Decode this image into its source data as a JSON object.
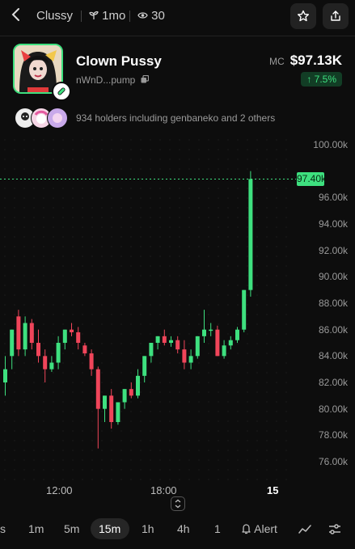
{
  "topbar": {
    "ticker": "Clussy",
    "age": "1mo",
    "views": "30"
  },
  "token": {
    "name": "Clown Pussy",
    "address": "nWnD...pump",
    "mc_label": "MC",
    "market_cap": "$97.13K",
    "change": "↑ 7.5%",
    "holders_text": "934 holders including genbaneko and 2 others"
  },
  "chart": {
    "y_labels": [
      "100.00k",
      "98.00k",
      "96.00k",
      "94.00k",
      "92.00k",
      "90.00k",
      "88.00k",
      "86.00k",
      "84.00k",
      "82.00k",
      "80.00k",
      "78.00k",
      "76.00k"
    ],
    "x_labels": [
      "12:00",
      "18:00",
      "15"
    ],
    "current_price_label": "97.40k",
    "current_price": 97.4,
    "up_color": "#3ee07f",
    "down_color": "#f0455a"
  },
  "chart_data": {
    "type": "candlestick",
    "ylim": [
      76,
      100
    ],
    "y_unit": "k",
    "candles": [
      {
        "o": 82,
        "h": 84,
        "l": 81,
        "c": 83
      },
      {
        "o": 84,
        "h": 86,
        "l": 83,
        "c": 86
      },
      {
        "o": 87,
        "h": 87.5,
        "l": 84,
        "c": 84.5
      },
      {
        "o": 84.5,
        "h": 87,
        "l": 84,
        "c": 86.5
      },
      {
        "o": 86.5,
        "h": 86.8,
        "l": 84.5,
        "c": 85
      },
      {
        "o": 85,
        "h": 86,
        "l": 83.5,
        "c": 84
      },
      {
        "o": 84,
        "h": 84.5,
        "l": 82,
        "c": 83
      },
      {
        "o": 83,
        "h": 84,
        "l": 82.8,
        "c": 83.5
      },
      {
        "o": 83.5,
        "h": 85.5,
        "l": 83,
        "c": 85
      },
      {
        "o": 85,
        "h": 86,
        "l": 84.5,
        "c": 86
      },
      {
        "o": 86,
        "h": 86.5,
        "l": 85.5,
        "c": 85.8
      },
      {
        "o": 85.8,
        "h": 86.2,
        "l": 84.5,
        "c": 85
      },
      {
        "o": 84.8,
        "h": 85,
        "l": 84,
        "c": 84.2
      },
      {
        "o": 84.2,
        "h": 84.5,
        "l": 82.5,
        "c": 83
      },
      {
        "o": 83,
        "h": 83.2,
        "l": 77,
        "c": 80
      },
      {
        "o": 80,
        "h": 81,
        "l": 79,
        "c": 81
      },
      {
        "o": 81,
        "h": 81.5,
        "l": 78.5,
        "c": 79
      },
      {
        "o": 79,
        "h": 80.5,
        "l": 78.8,
        "c": 80.5
      },
      {
        "o": 80.5,
        "h": 81.5,
        "l": 80,
        "c": 81.5
      },
      {
        "o": 81.5,
        "h": 82,
        "l": 80.8,
        "c": 81
      },
      {
        "o": 81,
        "h": 83,
        "l": 80.8,
        "c": 82.5
      },
      {
        "o": 82.5,
        "h": 84,
        "l": 82,
        "c": 84
      },
      {
        "o": 84,
        "h": 85,
        "l": 83.5,
        "c": 85
      },
      {
        "o": 85,
        "h": 85.5,
        "l": 84.5,
        "c": 85.5
      },
      {
        "o": 85.5,
        "h": 86,
        "l": 84.8,
        "c": 85
      },
      {
        "o": 85,
        "h": 85.5,
        "l": 84.7,
        "c": 85.2
      },
      {
        "o": 85.2,
        "h": 85.5,
        "l": 84.2,
        "c": 84.5
      },
      {
        "o": 84.5,
        "h": 85.2,
        "l": 83,
        "c": 83.5
      },
      {
        "o": 83.5,
        "h": 84.5,
        "l": 83,
        "c": 84
      },
      {
        "o": 84,
        "h": 85.5,
        "l": 83.8,
        "c": 85.5
      },
      {
        "o": 85.5,
        "h": 87.5,
        "l": 85,
        "c": 86
      },
      {
        "o": 86,
        "h": 86.5,
        "l": 85.5,
        "c": 86
      },
      {
        "o": 86,
        "h": 86.3,
        "l": 84,
        "c": 84
      },
      {
        "o": 84,
        "h": 85.2,
        "l": 83.8,
        "c": 84.8
      },
      {
        "o": 84.8,
        "h": 85.5,
        "l": 84.5,
        "c": 85.2
      },
      {
        "o": 85.2,
        "h": 86.2,
        "l": 85,
        "c": 86
      },
      {
        "o": 86,
        "h": 89,
        "l": 85.8,
        "c": 89
      },
      {
        "o": 89,
        "h": 98,
        "l": 88.5,
        "c": 97.4
      }
    ]
  },
  "timeframes": {
    "s": "s",
    "m1": "1m",
    "m5": "5m",
    "m15": "15m",
    "h1": "1h",
    "h4": "4h",
    "d1": "1"
  },
  "alert_label": "Alert"
}
